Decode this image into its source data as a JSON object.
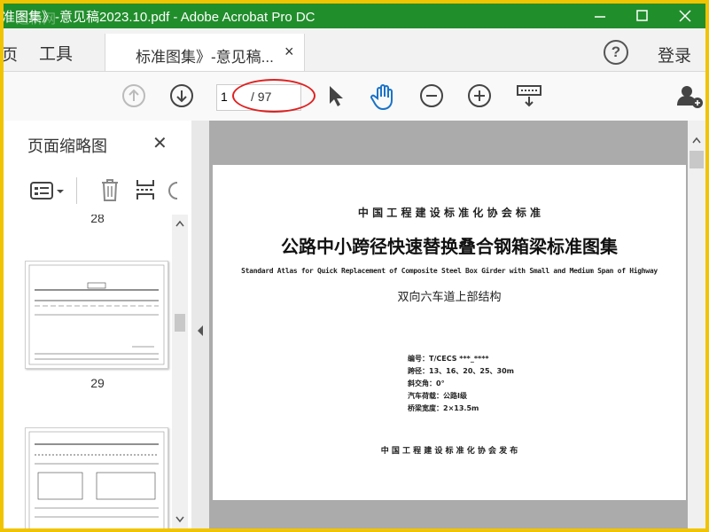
{
  "window": {
    "title": "准图集》-意见稿2023.10.pdf - Adobe Acrobat Pro DC",
    "watermark": "道桥网"
  },
  "tabs": {
    "prev_label": "页",
    "tools_label": "工具",
    "document_tab_label": "标准图集》-意见稿...",
    "close_symbol": "×",
    "help_symbol": "?",
    "login_label": "登录"
  },
  "toolbar": {
    "current_page": "1",
    "total_pages": "/ 97"
  },
  "thumbnail_panel": {
    "title": "页面缩略图",
    "close_symbol": "✕",
    "page_label_top": "28",
    "page_label_29": "29"
  },
  "document": {
    "org_header": "中 国 工 程 建 设 标 准 化 协 会 标 准",
    "title": "公路中小跨径快速替换叠合钢箱梁标准图集",
    "subtitle_en": "Standard Atlas for Quick Replacement of Composite Steel Box Girder with Small and Medium Span of Highway",
    "subtitle": "双向六车道上部结构",
    "info": [
      "编号：T/CECS ***_****",
      "跨径：13、16、20、25、30m",
      "斜交角：0°",
      "汽车荷载：公路Ⅰ级",
      "桥梁宽度：2×13.5m"
    ],
    "publisher": "中 国 工 程 建 设 标 准 化 协 会 发 布"
  },
  "colors": {
    "title_bar": "#218e2c",
    "frame_border": "#f0c400",
    "annotation_oval": "#e02020",
    "hand_tool": "#1a73c8"
  }
}
